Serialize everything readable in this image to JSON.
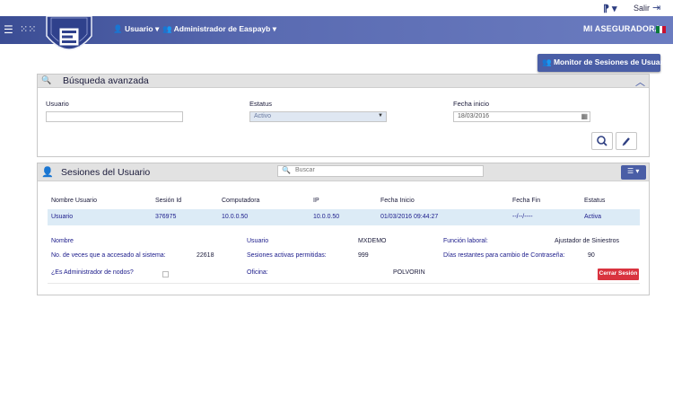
{
  "topbar": {
    "translate_icon": "translate-icon",
    "logout_label": "Salir",
    "logout_icon": "exit-icon"
  },
  "nav": {
    "menu_icon": "hamburger-icon",
    "apps_icon": "grid-icon",
    "user_menu": "Usuario",
    "admin_menu": "Administrador de Easpayb",
    "brand": "MI ASEGURADORA",
    "flag_colors": [
      "#0a7a3a",
      "#ffffff",
      "#c8102e"
    ],
    "bar_color": "#4a5ea6"
  },
  "actions": {
    "monitor_label": "Monitor de Sesiones de Usuario"
  },
  "advanced_search": {
    "title": "Búsqueda avanzada",
    "usuario_label": "Usuario",
    "usuario_value": "",
    "estatus_label": "Estatus",
    "estatus_value": "Activo",
    "fecha_label": "Fecha inicio",
    "fecha_value": "18/03/2016"
  },
  "sessions": {
    "title": "Sesiones del Usuario",
    "search_placeholder": "Buscar",
    "columns": [
      "Nombre Usuario",
      "Sesión Id",
      "Computadora",
      "IP",
      "Fecha Inicio",
      "Fecha Fin",
      "Estatus"
    ],
    "rows": [
      [
        "Usuario",
        "376975",
        "10.0.0.50",
        "10.0.0.50",
        "01/03/2016 09:44:27",
        "--/--/----",
        "Activa"
      ]
    ],
    "detail": {
      "nombre_label": "Nombre",
      "usuario_label": "Usuario",
      "usuario_value": "MXDEMO",
      "funcion_label": "Función laboral:",
      "funcion_value": "Ajustador de Siniestros",
      "accesos_label": "No. de veces que a accesado al sistema:",
      "accesos_value": "22618",
      "sesiones_label": "Sesiones activas permitidas:",
      "sesiones_value": "999",
      "dias_label": "Días restantes para cambio de Contraseña:",
      "dias_value": "90",
      "admin_label": "¿Es Administrador de nodos?",
      "oficina_label": "Oficina:",
      "oficina_value": "POLVORIN",
      "close_label": "Cerrar Sesión"
    }
  }
}
